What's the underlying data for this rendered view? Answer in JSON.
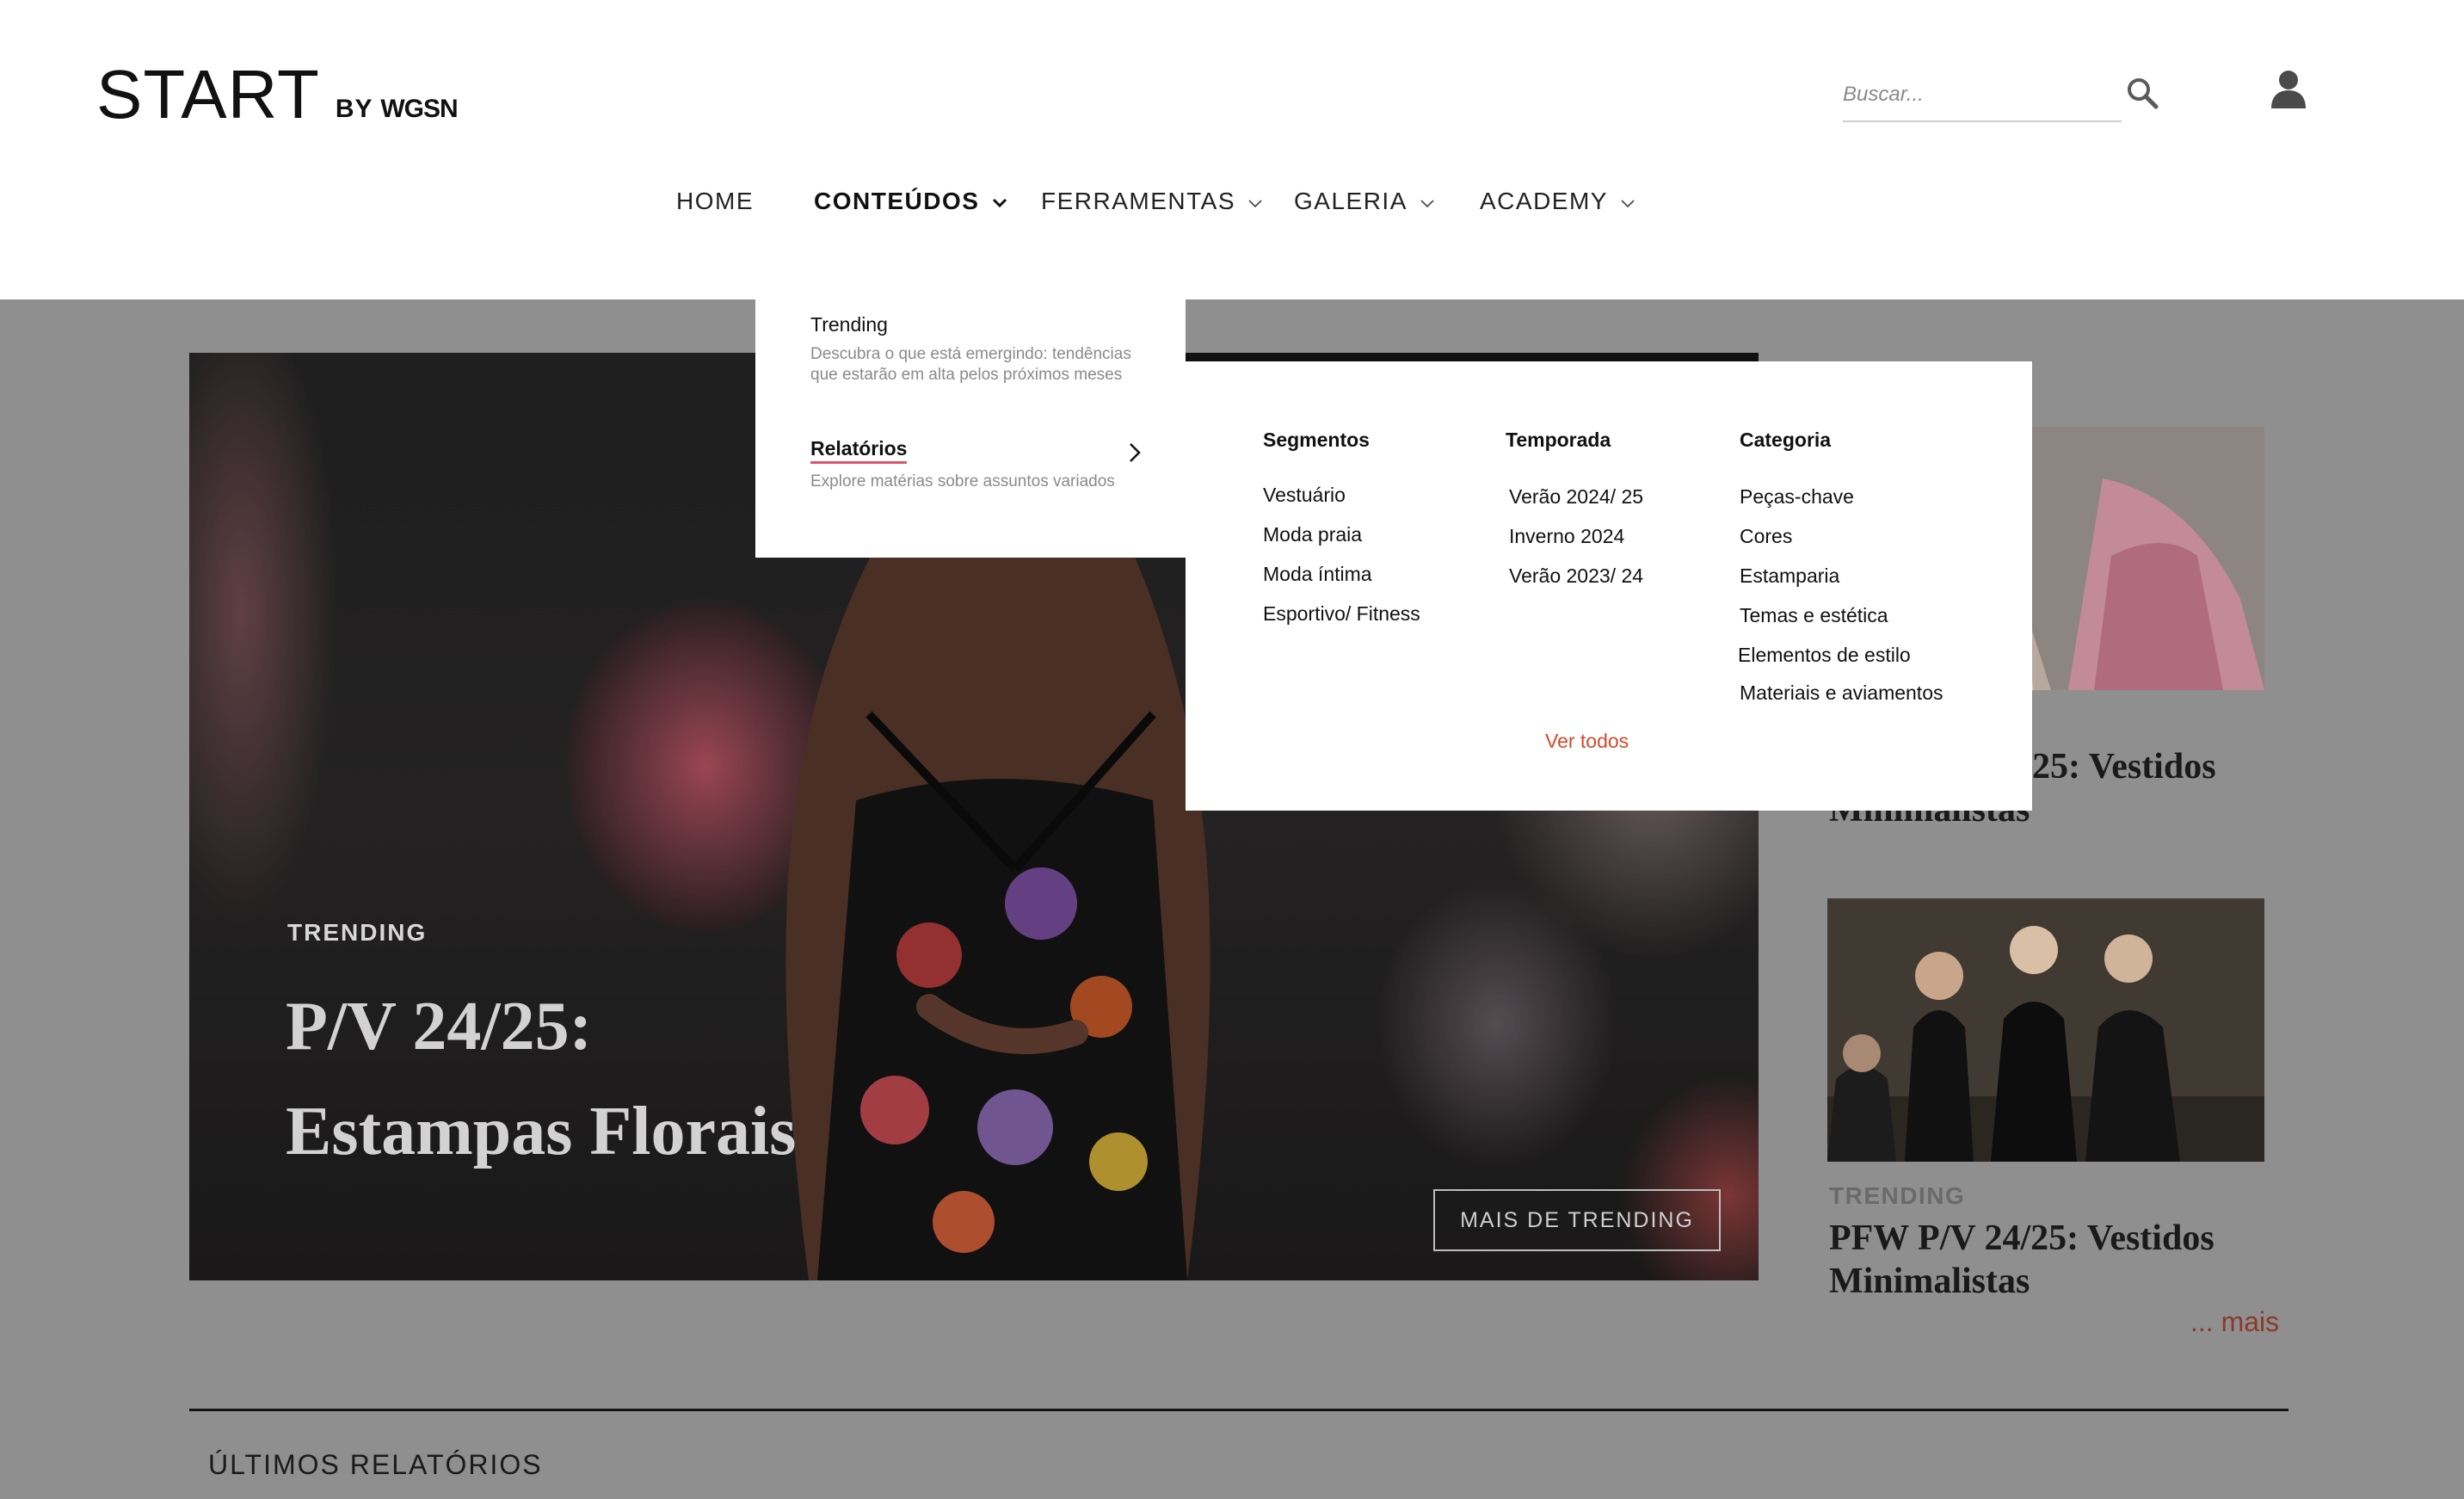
{
  "header": {
    "logo_main": "START",
    "logo_by": "BY",
    "logo_brand": "WGSN",
    "search_placeholder": "Buscar..."
  },
  "nav": [
    {
      "label": "HOME"
    },
    {
      "label": "CONTEÚDOS"
    },
    {
      "label": "FERRAMENTAS"
    },
    {
      "label": "GALERIA"
    },
    {
      "label": "ACADEMY"
    }
  ],
  "dropdown_main": {
    "items": [
      {
        "title": "Trending",
        "description": "Descubra o que está emergindo: tendências que estarão em alta pelos próximos meses"
      },
      {
        "title": "Relatórios",
        "description": "Explore matérias sobre assuntos variados"
      }
    ]
  },
  "dropdown_sub": {
    "columns": [
      {
        "heading": "Segmentos",
        "items": [
          "Vestuário",
          "Moda praia",
          "Moda íntima",
          "Esportivo/ Fitness"
        ]
      },
      {
        "heading": "Temporada",
        "items": [
          "Verão 2024/ 25",
          "Inverno 2024",
          "Verão 2023/ 24"
        ]
      },
      {
        "heading": "Categoria",
        "items": [
          "Peças-chave",
          "Cores",
          "Estamparia",
          "Temas e estética",
          "Elementos de estilo",
          "Materiais e aviamentos"
        ]
      }
    ],
    "see_all": "Ver todos"
  },
  "hero": {
    "eyebrow": "TRENDING",
    "title_line1": "P/V 24/25:",
    "title_line2": "Estampas Florais",
    "button": "MAIS DE TRENDING"
  },
  "side_cards": [
    {
      "title_visible": "25: Vestidos",
      "title_line2_partial": "Minimalistas"
    },
    {
      "eyebrow": "TRENDING",
      "title_line1": "PFW P/V 24/25: Vestidos",
      "title_line2": "Minimalistas",
      "more": "... mais"
    }
  ],
  "latest": {
    "heading": "ÚLTIMOS RELATÓRIOS"
  },
  "colors": {
    "accent_red": "#d24a2e",
    "underline_pink": "#d9576c",
    "overlay_gray": "#8f8f8f"
  }
}
